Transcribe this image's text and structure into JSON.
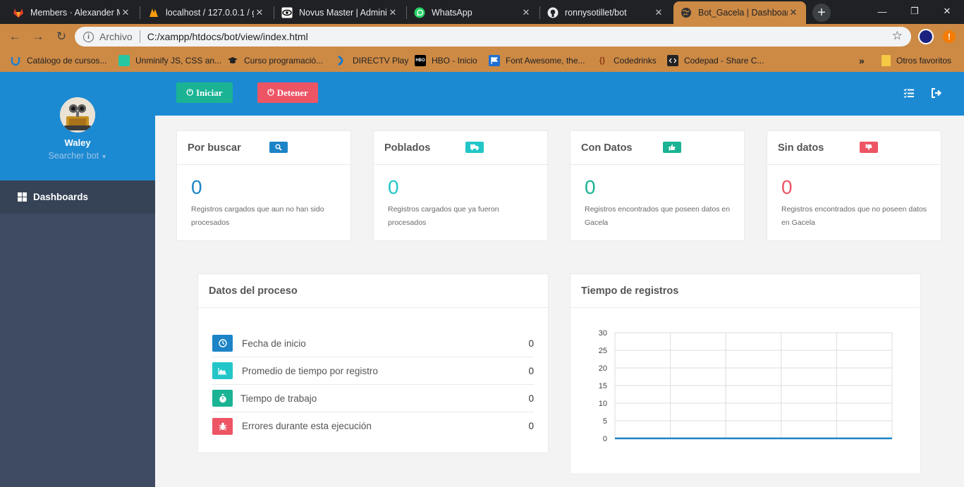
{
  "browser": {
    "tabs": [
      {
        "title": "Members · Alexander M",
        "icon": "gitlab-icon"
      },
      {
        "title": "localhost / 127.0.0.1 / g",
        "icon": "phpmyadmin-icon"
      },
      {
        "title": "Novus Master | Adminis",
        "icon": "eye-icon"
      },
      {
        "title": "WhatsApp",
        "icon": "whatsapp-icon"
      },
      {
        "title": "ronnysotillet/bot",
        "icon": "github-icon"
      },
      {
        "title": "Bot_Gacela | Dashboard",
        "icon": "globe-icon",
        "active": true
      }
    ],
    "address": {
      "scheme": "Archivo",
      "url": "C:/xampp/htdocs/bot/view/index.html"
    },
    "bookmarks": [
      {
        "label": "Catálogo de cursos...",
        "icon": "udemy-icon"
      },
      {
        "label": "Unminify JS, CSS an...",
        "icon": "unminify-icon"
      },
      {
        "label": "Curso programació...",
        "icon": "graduation-cap-icon"
      },
      {
        "label": "DIRECTV Play",
        "icon": "directv-icon"
      },
      {
        "label": "HBO - Inicio",
        "icon": "hbo-icon"
      },
      {
        "label": "Font Awesome, the...",
        "icon": "flag-icon"
      },
      {
        "label": "Codedrinks",
        "icon": "braces-icon"
      },
      {
        "label": "Codepad - Share C...",
        "icon": "codepad-icon"
      }
    ],
    "overflow_glyph": "»",
    "other_bookmarks": "Otros favoritos",
    "hbo_badge": "HBO",
    "braces_glyph": "{}",
    "notification_glyph": "!"
  },
  "sidebar": {
    "user_name": "Waley",
    "user_role": "Searcher bot",
    "nav_item": "Dashboards"
  },
  "topbar": {
    "start_button": "Iniciar",
    "stop_button": "Detener"
  },
  "stats": [
    {
      "title": "Por buscar",
      "value": "0",
      "description": "Registros cargados que aun no han sido procesados",
      "color": "#1c84c6",
      "icon": "search-icon"
    },
    {
      "title": "Poblados",
      "value": "0",
      "description": "Registros cargados que ya fueron procesados",
      "color": "#23c6c8",
      "icon": "truck-icon"
    },
    {
      "title": "Con Datos",
      "value": "0",
      "description": "Registros encontrados que poseen datos en Gacela",
      "color": "#1ab394",
      "icon": "thumbs-up-icon"
    },
    {
      "title": "Sin datos",
      "value": "0",
      "description": "Registros encontrados que no poseen datos en Gacela",
      "color": "#ed5565",
      "icon": "thumbs-down-icon"
    }
  ],
  "process": {
    "title": "Datos del proceso",
    "rows": [
      {
        "label": "Fecha de inicio",
        "value": "0",
        "color": "#1c84c6",
        "icon": "clock-icon"
      },
      {
        "label": "Promedio de tiempo por registro",
        "value": "0",
        "color": "#23c6c8",
        "icon": "area-chart-icon"
      },
      {
        "label": "Tiempo de trabajo",
        "value": "0",
        "color": "#1ab394",
        "icon": "stopwatch-icon"
      },
      {
        "label": "Errores durante esta ejecución",
        "value": "0",
        "color": "#ed5565",
        "icon": "bug-icon"
      }
    ]
  },
  "chart_panel": {
    "title": "Tiempo de registros"
  },
  "chart_data": {
    "type": "line",
    "x": [
      "",
      "",
      "",
      "",
      "",
      ""
    ],
    "series": [
      {
        "values": [
          0,
          0,
          0,
          0,
          0,
          0
        ],
        "color": "#1c84c6"
      }
    ],
    "yticks": [
      0,
      5,
      10,
      15,
      20,
      25,
      30
    ],
    "ylim": [
      0,
      30
    ],
    "grid": true,
    "title": "",
    "xlabel": "",
    "ylabel": ""
  }
}
